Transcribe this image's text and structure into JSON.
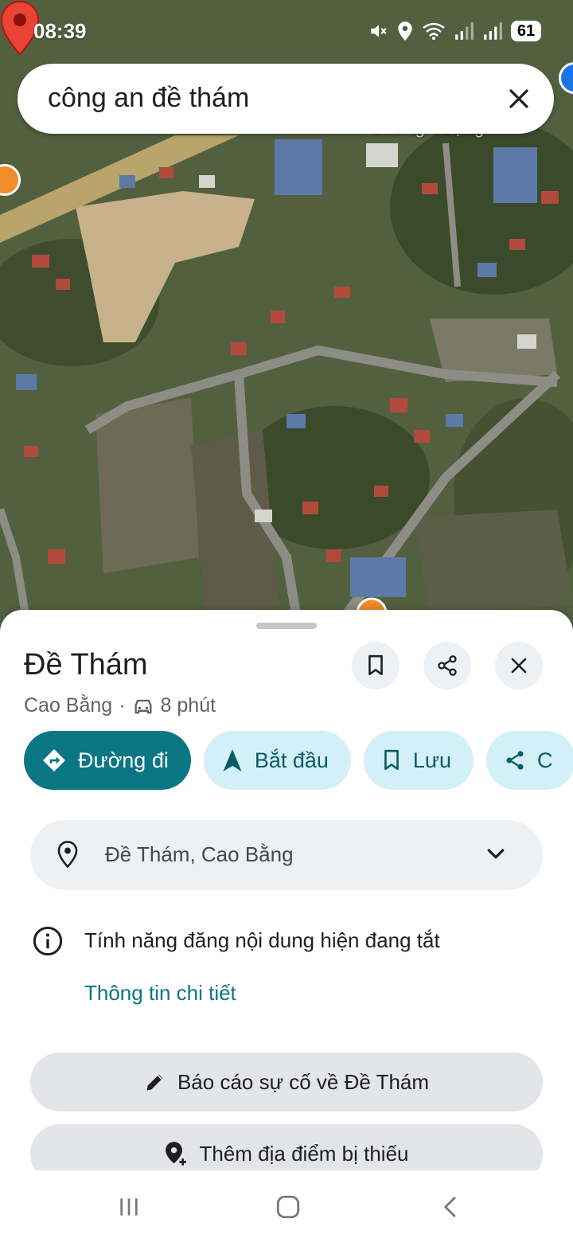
{
  "status": {
    "time": "08:39",
    "battery": "61",
    "icons": [
      "mute-icon",
      "location-icon",
      "wifi-icon",
      "signal-icon",
      "signal-icon",
      "battery-icon"
    ]
  },
  "search": {
    "query": "công an đề thám",
    "clear_icon": "close-icon"
  },
  "map": {
    "label_fragment": "Lương Vượng",
    "label_fragment_right": "gia",
    "pin_color": "#ea4335"
  },
  "place": {
    "title": "Đề Thám",
    "region": "Cao Bằng",
    "separator": "·",
    "travel_mode_icon": "car-icon",
    "travel_time": "8 phút"
  },
  "header_buttons": {
    "save_icon": "bookmark-icon",
    "share_icon": "share-icon",
    "close_icon": "close-icon"
  },
  "actions": [
    {
      "label": "Đường đi",
      "icon": "directions-icon",
      "primary": true
    },
    {
      "label": "Bắt đầu",
      "icon": "navigation-arrow-icon",
      "primary": false
    },
    {
      "label": "Lưu",
      "icon": "bookmark-icon",
      "primary": false
    },
    {
      "label": "C",
      "icon": "share-icon",
      "primary": false
    }
  ],
  "address": {
    "text": "Đề Thám, Cao Bằng",
    "icon": "location-pin-icon",
    "expand_icon": "chevron-down-icon"
  },
  "notice": {
    "text": "Tính năng đăng nội dung hiện đang tắt",
    "icon": "info-icon",
    "link": "Thông tin chi tiết"
  },
  "buttons": {
    "report": "Báo cáo sự cố về Đề Thám",
    "add_place": "Thêm địa điểm bị thiếu"
  },
  "colors": {
    "accent": "#0b7684",
    "chip_bg": "#d3f0f8",
    "chip_text": "#0b5a66",
    "card_bg": "#eef1f4"
  },
  "nav": {
    "recents_icon": "recents-icon",
    "home_icon": "home-icon",
    "back_icon": "back-icon"
  }
}
